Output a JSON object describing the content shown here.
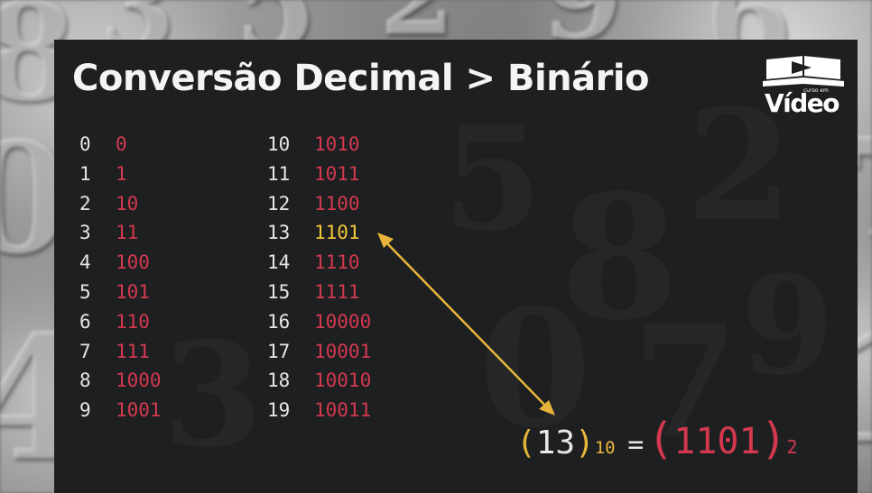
{
  "title": "Conversão Decimal > Binário",
  "logo": {
    "small_text": "curso em",
    "word": "Vídeo",
    "icon": "play-book-icon"
  },
  "colors": {
    "binary": "#d2394f",
    "highlight": "#f3c636",
    "decimal": "#e6e6e6",
    "slide_background": "#1e1f21"
  },
  "table_left": [
    {
      "decimal": "0",
      "binary": "0"
    },
    {
      "decimal": "1",
      "binary": "1"
    },
    {
      "decimal": "2",
      "binary": "10"
    },
    {
      "decimal": "3",
      "binary": "11"
    },
    {
      "decimal": "4",
      "binary": "100"
    },
    {
      "decimal": "5",
      "binary": "101"
    },
    {
      "decimal": "6",
      "binary": "110"
    },
    {
      "decimal": "7",
      "binary": "111"
    },
    {
      "decimal": "8",
      "binary": "1000"
    },
    {
      "decimal": "9",
      "binary": "1001"
    }
  ],
  "table_right": [
    {
      "decimal": "10",
      "binary": "1010"
    },
    {
      "decimal": "11",
      "binary": "1011"
    },
    {
      "decimal": "12",
      "binary": "1100"
    },
    {
      "decimal": "13",
      "binary": "1101",
      "highlight": true
    },
    {
      "decimal": "14",
      "binary": "1110"
    },
    {
      "decimal": "15",
      "binary": "1111"
    },
    {
      "decimal": "16",
      "binary": "10000"
    },
    {
      "decimal": "17",
      "binary": "10001"
    },
    {
      "decimal": "18",
      "binary": "10010"
    },
    {
      "decimal": "19",
      "binary": "10011"
    }
  ],
  "formula": {
    "open": "(",
    "decimal_value": "13",
    "close": ")",
    "decimal_base": "10",
    "equals": "=",
    "binary_value": "1101",
    "binary_base": "2"
  }
}
